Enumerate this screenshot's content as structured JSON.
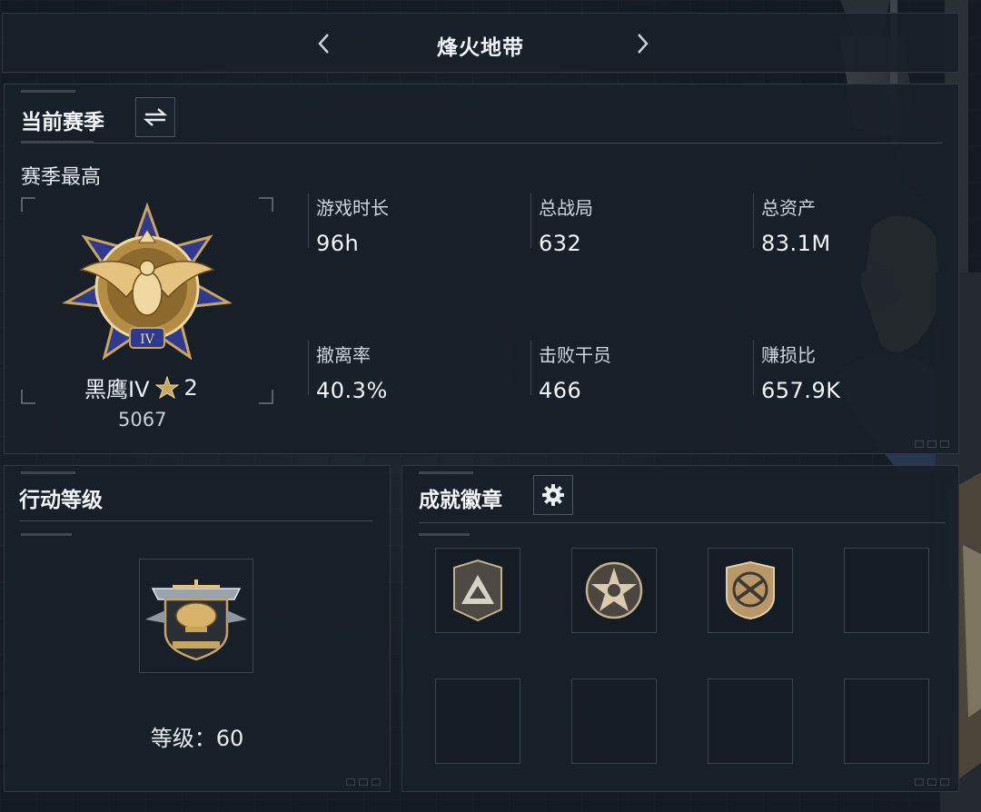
{
  "top_bar": {
    "prev_icon": "chevron-left-icon",
    "next_icon": "chevron-right-icon",
    "title": "烽火地带"
  },
  "season": {
    "title": "当前赛季",
    "switch_icon": "swap-arrows-icon",
    "best_label": "赛季最高",
    "rank": {
      "name": "黑鹰IV",
      "stars": "2",
      "score": "5067",
      "numeral": "IV",
      "icon": "black-hawk-rank-medal-icon"
    },
    "stats": [
      {
        "label": "游戏时长",
        "value": "96h"
      },
      {
        "label": "总战局",
        "value": "632"
      },
      {
        "label": "总资产",
        "value": "83.1M"
      },
      {
        "label": "撤离率",
        "value": "40.3%"
      },
      {
        "label": "击败干员",
        "value": "466"
      },
      {
        "label": "赚损比",
        "value": "657.9K"
      }
    ]
  },
  "action_level": {
    "title": "行动等级",
    "level_label": "等级：60",
    "icon": "helicopter-level-badge-icon"
  },
  "achievements": {
    "title": "成就徽章",
    "settings_icon": "gear-icon",
    "badges": [
      {
        "icon": "triangle-shield-badge-icon"
      },
      {
        "icon": "star-skull-badge-icon"
      },
      {
        "icon": "rifle-crossed-badge-icon"
      },
      {
        "icon": "empty-slot"
      },
      {
        "icon": "empty-slot"
      },
      {
        "icon": "empty-slot"
      },
      {
        "icon": "empty-slot"
      },
      {
        "icon": "empty-slot"
      }
    ]
  },
  "colors": {
    "background": "#121821",
    "panel": "#181f28",
    "gold": "#c9a45c",
    "blue_star": "#2e3a8f",
    "text": "#e9edf2"
  }
}
